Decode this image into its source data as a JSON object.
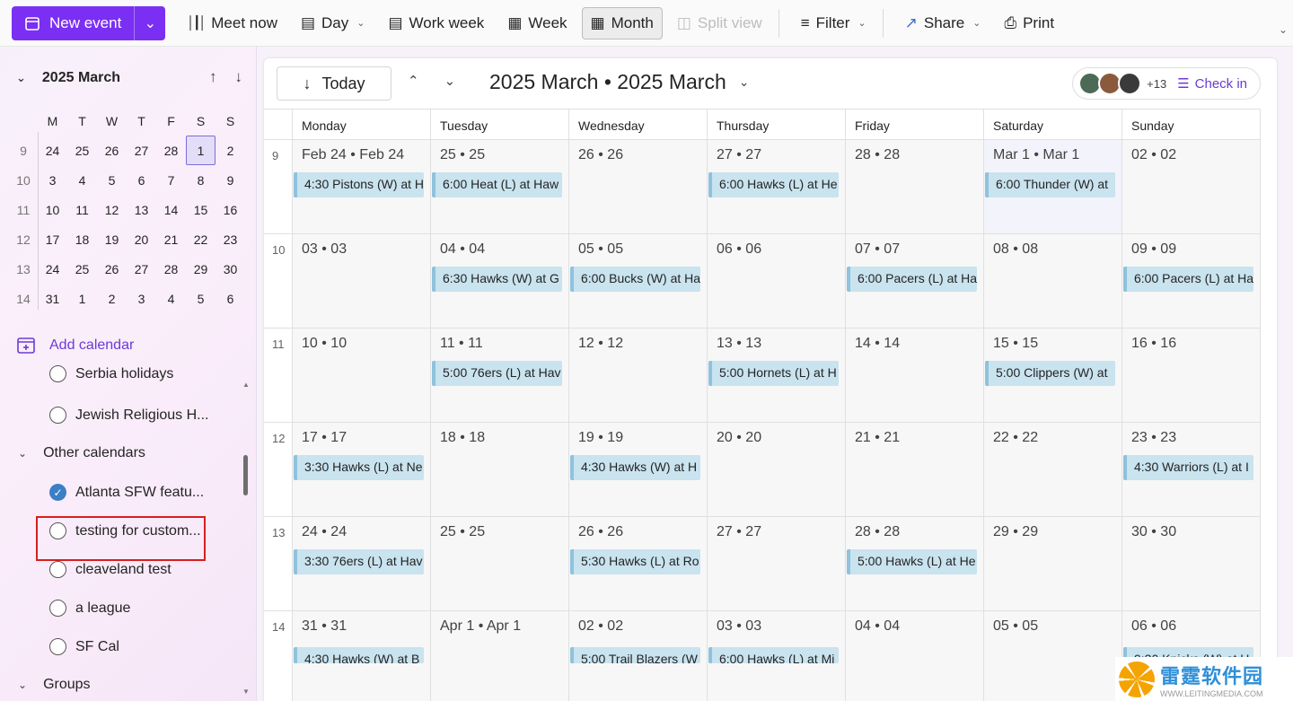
{
  "toolbar": {
    "new_event": "New event",
    "meet_now": "Meet now",
    "day": "Day",
    "work_week": "Work week",
    "week": "Week",
    "month": "Month",
    "split_view": "Split view",
    "filter": "Filter",
    "share": "Share",
    "print": "Print"
  },
  "mini_calendar": {
    "title": "2025 March",
    "dow": [
      "M",
      "T",
      "W",
      "T",
      "F",
      "S",
      "S"
    ],
    "weeks": [
      {
        "wk": "9",
        "days": [
          "24",
          "25",
          "26",
          "27",
          "28",
          "1",
          "2"
        ]
      },
      {
        "wk": "10",
        "days": [
          "3",
          "4",
          "5",
          "6",
          "7",
          "8",
          "9"
        ]
      },
      {
        "wk": "11",
        "days": [
          "10",
          "11",
          "12",
          "13",
          "14",
          "15",
          "16"
        ]
      },
      {
        "wk": "12",
        "days": [
          "17",
          "18",
          "19",
          "20",
          "21",
          "22",
          "23"
        ]
      },
      {
        "wk": "13",
        "days": [
          "24",
          "25",
          "26",
          "27",
          "28",
          "29",
          "30"
        ]
      },
      {
        "wk": "14",
        "days": [
          "31",
          "1",
          "2",
          "3",
          "4",
          "5",
          "6"
        ]
      }
    ]
  },
  "sidebar": {
    "add_calendar": "Add calendar",
    "calendars": [
      {
        "label": "Serbia holidays",
        "checked": false
      },
      {
        "label": "Jewish Religious H...",
        "checked": false
      }
    ],
    "other_calendars_header": "Other calendars",
    "other_calendars": [
      {
        "label": "Atlanta SFW featu...",
        "checked": true
      },
      {
        "label": "testing for custom...",
        "checked": false
      },
      {
        "label": "cleaveland test",
        "checked": false
      },
      {
        "label": "a league",
        "checked": false
      },
      {
        "label": "SF Cal",
        "checked": false
      }
    ],
    "groups_header": "Groups"
  },
  "calendar": {
    "today_label": "Today",
    "title": "2025 March • 2025 March",
    "check_in": "Check in",
    "more_people": "+13",
    "day_headers": [
      "Monday",
      "Tuesday",
      "Wednesday",
      "Thursday",
      "Friday",
      "Saturday",
      "Sunday"
    ],
    "weeks": [
      {
        "wk": "9",
        "days": [
          {
            "label": "Feb 24 • Feb 24",
            "event": "4:30 Pistons (W) at H"
          },
          {
            "label": "25 • 25",
            "event": "6:00 Heat (L) at Haw"
          },
          {
            "label": "26 • 26",
            "event": ""
          },
          {
            "label": "27 • 27",
            "event": "6:00 Hawks (L) at He"
          },
          {
            "label": "28 • 28",
            "event": ""
          },
          {
            "label": "Mar 1 • Mar 1",
            "event": "6:00 Thunder (W) at"
          },
          {
            "label": "02 • 02",
            "event": ""
          }
        ]
      },
      {
        "wk": "10",
        "days": [
          {
            "label": "03 • 03",
            "event": ""
          },
          {
            "label": "04 • 04",
            "event": "6:30 Hawks (W) at G"
          },
          {
            "label": "05 • 05",
            "event": "6:00 Bucks (W) at Ha"
          },
          {
            "label": "06 • 06",
            "event": ""
          },
          {
            "label": "07 • 07",
            "event": "6:00 Pacers (L) at Ha"
          },
          {
            "label": "08 • 08",
            "event": ""
          },
          {
            "label": "09 • 09",
            "event": "6:00 Pacers (L) at Ha"
          }
        ]
      },
      {
        "wk": "11",
        "days": [
          {
            "label": "10 • 10",
            "event": ""
          },
          {
            "label": "11 • 11",
            "event": "5:00 76ers (L) at Hav"
          },
          {
            "label": "12 • 12",
            "event": ""
          },
          {
            "label": "13 • 13",
            "event": "5:00 Hornets (L) at H"
          },
          {
            "label": "14 • 14",
            "event": ""
          },
          {
            "label": "15 • 15",
            "event": "5:00 Clippers (W) at"
          },
          {
            "label": "16 • 16",
            "event": ""
          }
        ]
      },
      {
        "wk": "12",
        "days": [
          {
            "label": "17 • 17",
            "event": "3:30 Hawks (L) at Ne"
          },
          {
            "label": "18 • 18",
            "event": ""
          },
          {
            "label": "19 • 19",
            "event": "4:30 Hawks (W) at H"
          },
          {
            "label": "20 • 20",
            "event": ""
          },
          {
            "label": "21 • 21",
            "event": ""
          },
          {
            "label": "22 • 22",
            "event": ""
          },
          {
            "label": "23 • 23",
            "event": "4:30 Warriors (L) at I"
          }
        ]
      },
      {
        "wk": "13",
        "days": [
          {
            "label": "24 • 24",
            "event": "3:30 76ers (L) at Hav"
          },
          {
            "label": "25 • 25",
            "event": ""
          },
          {
            "label": "26 • 26",
            "event": "5:30 Hawks (L) at Ro"
          },
          {
            "label": "27 • 27",
            "event": ""
          },
          {
            "label": "28 • 28",
            "event": "5:00 Hawks (L) at He"
          },
          {
            "label": "29 • 29",
            "event": ""
          },
          {
            "label": "30 • 30",
            "event": ""
          }
        ]
      },
      {
        "wk": "14",
        "days": [
          {
            "label": "31 • 31",
            "event": "4:30 Hawks (W) at B"
          },
          {
            "label": "Apr 1 • Apr 1",
            "event": ""
          },
          {
            "label": "02 • 02",
            "event": "5:00 Trail Blazers (W"
          },
          {
            "label": "03 • 03",
            "event": "6:00 Hawks (L) at Mi"
          },
          {
            "label": "04 • 04",
            "event": ""
          },
          {
            "label": "05 • 05",
            "event": ""
          },
          {
            "label": "06 • 06",
            "event": "9:30 Knicks (W) at H"
          }
        ]
      }
    ]
  },
  "watermark": {
    "cn": "雷霆软件园",
    "en": "WWW.LEITINGMEDIA.COM"
  },
  "colors": {
    "accent": "#7b2ff2",
    "event_bg": "#c9e3ef",
    "highlight_box": "#d71f1f"
  }
}
